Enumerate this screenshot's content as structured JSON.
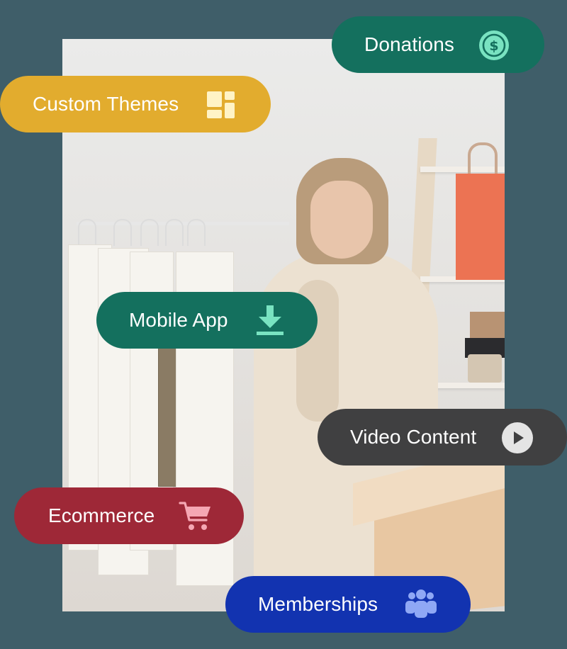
{
  "features": {
    "donations": {
      "label": "Donations",
      "icon": "dollar-coin-icon"
    },
    "custom_themes": {
      "label": "Custom Themes",
      "icon": "layout-grid-icon"
    },
    "mobile_app": {
      "label": "Mobile App",
      "icon": "download-icon"
    },
    "video_content": {
      "label": "Video Content",
      "icon": "play-icon"
    },
    "ecommerce": {
      "label": "Ecommerce",
      "icon": "shopping-cart-icon"
    },
    "memberships": {
      "label": "Memberships",
      "icon": "group-users-icon"
    }
  },
  "colors": {
    "background": "#3f5e69",
    "donations": "#14705e",
    "custom_themes": "#e2ac2e",
    "mobile_app": "#14705e",
    "video_content": "#404041",
    "ecommerce": "#9e2837",
    "memberships": "#1233b0"
  }
}
